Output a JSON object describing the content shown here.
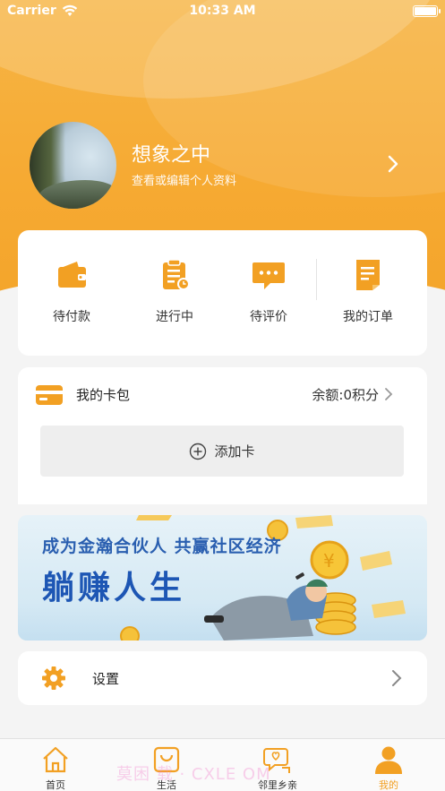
{
  "status_bar": {
    "carrier": "Carrier",
    "time": "10:33 AM"
  },
  "profile": {
    "name": "想象之中",
    "subtitle": "查看或编辑个人资料"
  },
  "orders": [
    {
      "label": "待付款",
      "icon": "wallet-icon"
    },
    {
      "label": "进行中",
      "icon": "clipboard-icon"
    },
    {
      "label": "待评价",
      "icon": "comment-icon"
    },
    {
      "label": "我的订单",
      "icon": "document-icon"
    }
  ],
  "wallet": {
    "title": "我的卡包",
    "balance": "余额:0积分",
    "add_card": "添加卡"
  },
  "banner": {
    "line1": "成为金瀚合伙人 共赢社区经济",
    "line2": "躺赚人生"
  },
  "settings": {
    "label": "设置"
  },
  "tabs": [
    {
      "label": "首页",
      "icon": "home-icon"
    },
    {
      "label": "生活",
      "icon": "shopping-bag-icon"
    },
    {
      "label": "邻里乡亲",
      "icon": "chat-heart-icon"
    },
    {
      "label": "我的",
      "icon": "person-icon"
    }
  ],
  "watermark": "莫困 载 · CXLE  OM",
  "colors": {
    "accent": "#f6aa33",
    "tab_active": "#f2a023",
    "banner_text": "#1d56b4"
  }
}
